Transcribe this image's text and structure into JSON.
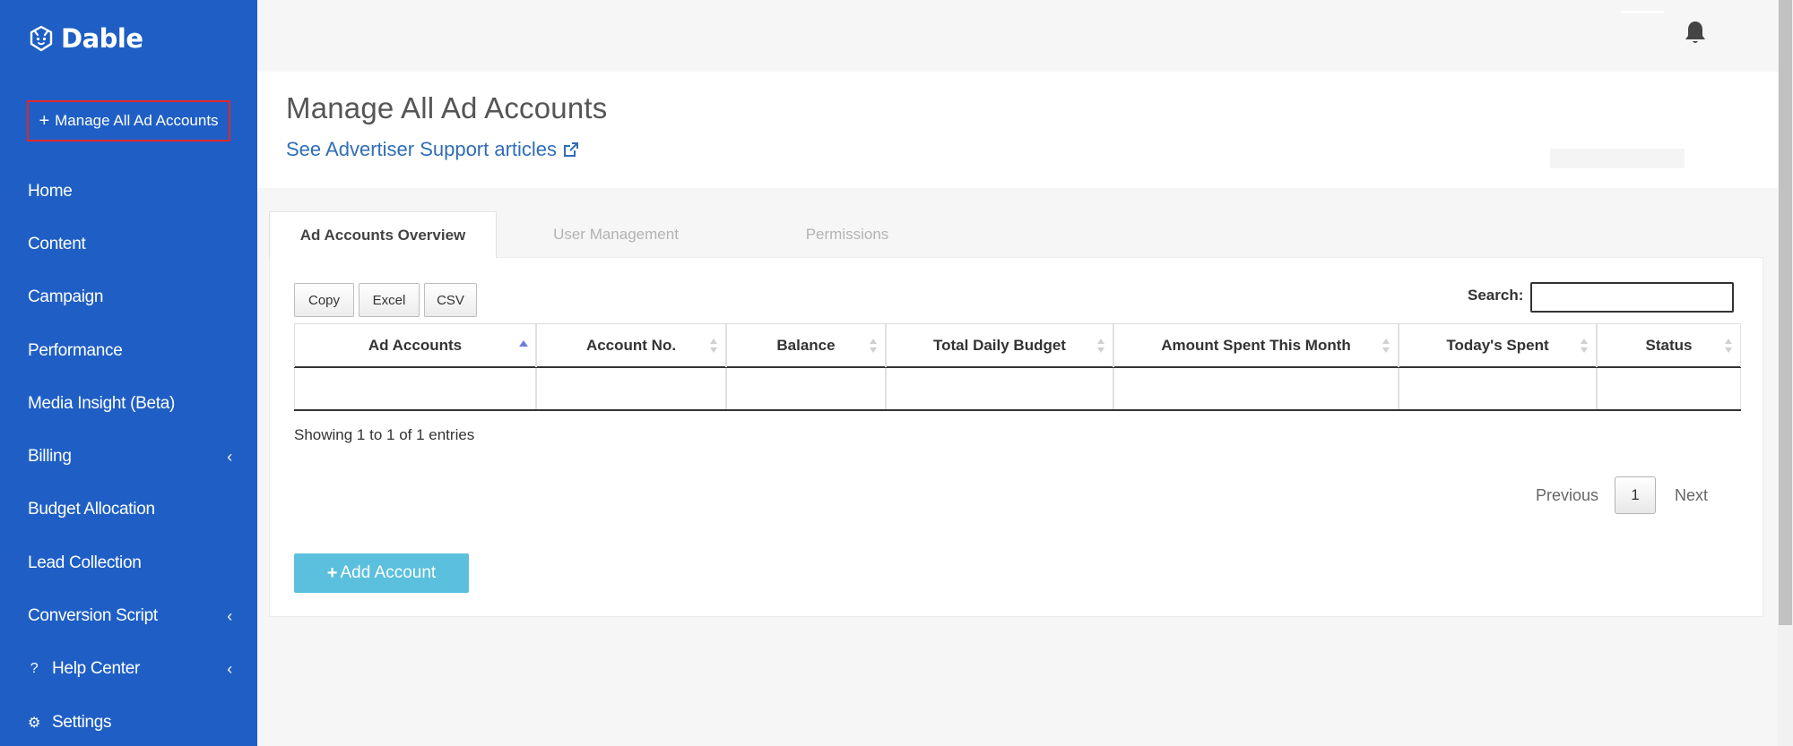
{
  "brand": {
    "name": "Dable",
    "accent": "#1f5fc5"
  },
  "sidebar": {
    "manage_button": "Manage All Ad Accounts",
    "items": [
      {
        "label": "Home",
        "chevron": ""
      },
      {
        "label": "Content",
        "chevron": ""
      },
      {
        "label": "Campaign",
        "chevron": ""
      },
      {
        "label": "Performance",
        "chevron": ""
      },
      {
        "label": "Media Insight (Beta)",
        "chevron": ""
      },
      {
        "label": "Billing",
        "chevron": "‹"
      },
      {
        "label": "Budget Allocation",
        "chevron": ""
      },
      {
        "label": "Lead Collection",
        "chevron": ""
      },
      {
        "label": "Conversion Script",
        "chevron": "‹"
      },
      {
        "label": "Help Center",
        "chevron": "‹",
        "icon": "?"
      },
      {
        "label": "Settings",
        "chevron": "",
        "icon": "⚙"
      }
    ]
  },
  "header": {
    "title": "Manage All Ad Accounts",
    "support_link": "See Advertiser Support articles"
  },
  "tabs": [
    {
      "label": "Ad Accounts Overview",
      "active": true
    },
    {
      "label": "User Management",
      "active": false
    },
    {
      "label": "Permissions",
      "active": false
    }
  ],
  "table_tools": {
    "copy": "Copy",
    "excel": "Excel",
    "csv": "CSV",
    "search_label": "Search:",
    "search_value": ""
  },
  "table": {
    "columns": [
      "Ad Accounts",
      "Account No.",
      "Balance",
      "Total Daily Budget",
      "Amount Spent This Month",
      "Today's Spent",
      "Status"
    ],
    "rows": [
      [
        "",
        "",
        "",
        "",
        "",
        "",
        ""
      ]
    ]
  },
  "pagination": {
    "info": "Showing 1 to 1 of 1 entries",
    "previous": "Previous",
    "page": "1",
    "next": "Next"
  },
  "add_account": "Add Account"
}
